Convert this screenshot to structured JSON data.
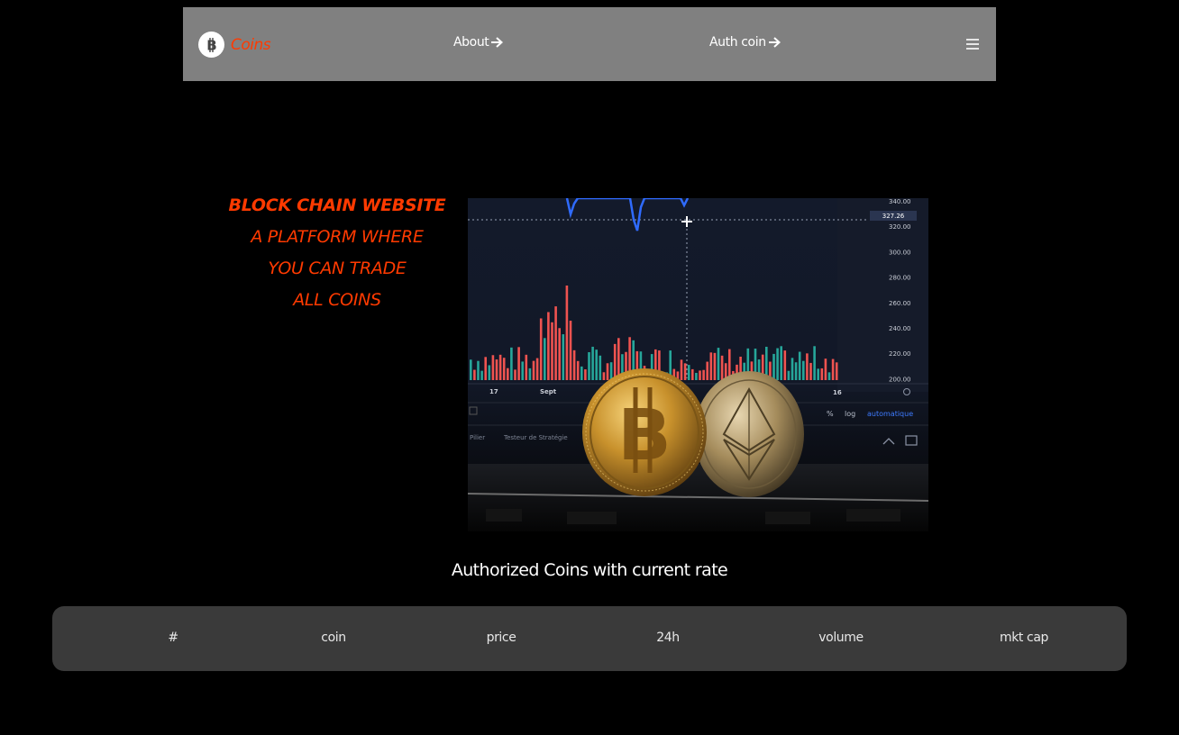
{
  "nav": {
    "brand": "Coins",
    "about": "About",
    "auth": "Auth coin"
  },
  "hero": {
    "headline": "BLOCK CHAIN WEBSITE",
    "lines": [
      "A PLATFORM WHERE",
      "YOU CAN TRADE",
      "ALL COINS"
    ],
    "image": {
      "price_ticks": [
        "340.00",
        "320.00",
        "300.00",
        "280.00",
        "260.00",
        "240.00",
        "220.00",
        "200.00"
      ],
      "price_flag": "327.26",
      "date_ticks": [
        "17",
        "Sept",
        "16"
      ],
      "toolbar": {
        "percent": "%",
        "log": "log",
        "auto": "automatique"
      },
      "panel_tabs": [
        "Pilier",
        "Testeur de Stratégie"
      ]
    }
  },
  "table": {
    "title": "Authorized Coins with current rate",
    "columns": [
      "#",
      "coin",
      "price",
      "24h",
      "volume",
      "mkt cap"
    ]
  },
  "colors": {
    "accent": "#ff3a00",
    "navbar": "#808080",
    "table_bg": "#3a3a3a",
    "bull": "#26a69a",
    "bear": "#ef5350"
  }
}
